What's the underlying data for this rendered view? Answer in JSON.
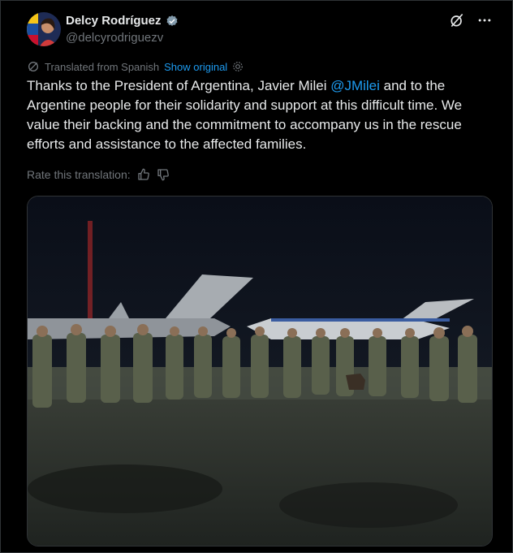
{
  "author": {
    "name": "Delcy Rodríguez",
    "handle": "@delcyrodriguezv"
  },
  "translation": {
    "label": "Translated from Spanish",
    "show_original": "Show original"
  },
  "tweet": {
    "text_before": "Thanks to the President of Argentina, Javier Milei ",
    "mention": "@JMilei",
    "text_after": " and to the Argentine people for their solidarity and support at this difficult time. We value their backing and the commitment to accompany us in the rescue efforts and assistance to the affected families."
  },
  "rate": {
    "label": "Rate this translation:"
  },
  "colors": {
    "accent": "#1d9bf0",
    "background": "#000000",
    "text": "#e7e9ea",
    "muted": "#71767b"
  },
  "icons": [
    "verified-badge-icon",
    "grok-icon",
    "more-icon",
    "translate-icon",
    "settings-icon",
    "thumbs-up-icon",
    "thumbs-down-icon"
  ]
}
